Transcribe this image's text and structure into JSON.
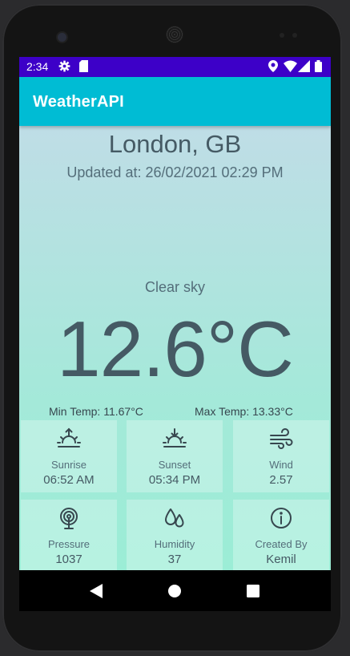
{
  "status": {
    "time": "2:34",
    "icons": [
      "gear-icon",
      "sd-card-icon",
      "location-icon",
      "wifi-icon",
      "signal-icon",
      "battery-icon"
    ]
  },
  "app": {
    "title": "WeatherAPI",
    "accent": "#00bcd4",
    "status_bar_color": "#3d00c8"
  },
  "weather": {
    "location": "London, GB",
    "updated": "Updated at: 26/02/2021 02:29 PM",
    "condition": "Clear sky",
    "temperature": "12.6°C",
    "min_temp": "Min Temp: 11.67°C",
    "max_temp": "Max Temp: 13.33°C"
  },
  "details": [
    {
      "label": "Sunrise",
      "value": "06:52 AM",
      "icon": "sunrise-icon"
    },
    {
      "label": "Sunset",
      "value": "05:34 PM",
      "icon": "sunset-icon"
    },
    {
      "label": "Wind",
      "value": "2.57",
      "icon": "wind-icon"
    },
    {
      "label": "Pressure",
      "value": "1037",
      "icon": "pressure-icon"
    },
    {
      "label": "Humidity",
      "value": "37",
      "icon": "humidity-icon"
    },
    {
      "label": "Created By",
      "value": "Kemil",
      "icon": "info-icon"
    }
  ],
  "nav": {
    "buttons": [
      "back-icon",
      "home-icon",
      "recents-icon"
    ]
  }
}
